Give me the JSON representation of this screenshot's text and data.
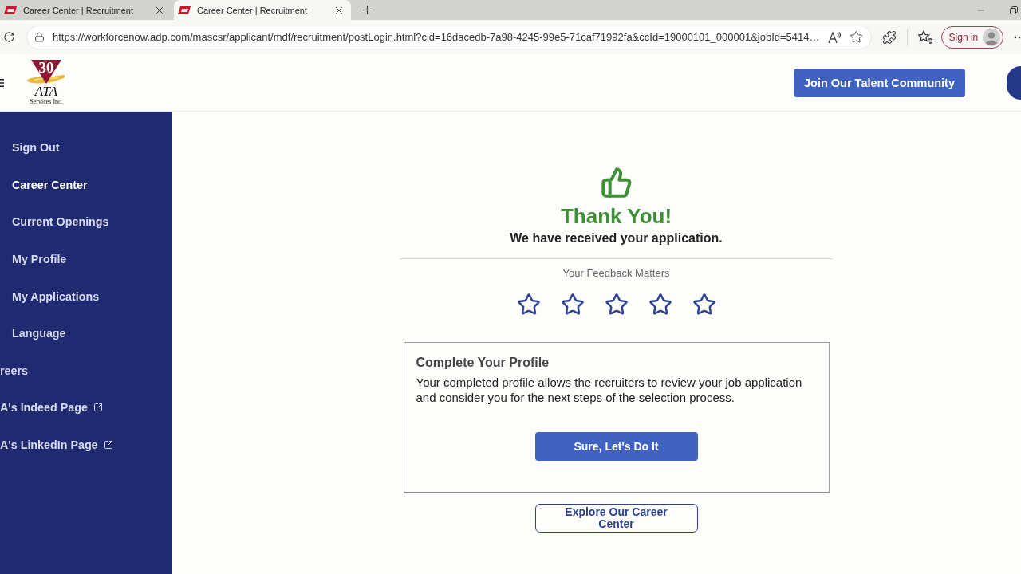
{
  "browser": {
    "tabs": [
      {
        "title": "Career Center | Recruitment",
        "selected": false
      },
      {
        "title": "Career Center | Recruitment",
        "selected": true
      }
    ],
    "address_bar": {
      "url": "https://workforcenow.adp.com/mascsr/applicant/mdf/recruitment/postLogin.html?cid=16dacedb-7a98-4245-99e5-71caf71992fa&ccId=19000101_000001&jobId=5414…"
    },
    "sign_in": "Sign in"
  },
  "header": {
    "logo": {
      "badge": "30",
      "name": "ATA",
      "tagline": "Services Inc."
    },
    "cta_button": "Join Our Talent Community"
  },
  "sidebar": {
    "items": [
      {
        "label": "Sign Out",
        "kind": "nested",
        "selected": false,
        "external": false
      },
      {
        "label": "Career Center",
        "kind": "nested",
        "selected": true,
        "external": false
      },
      {
        "label": "Current Openings",
        "kind": "nested",
        "selected": false,
        "external": false
      },
      {
        "label": "My Profile",
        "kind": "nested",
        "selected": false,
        "external": false
      },
      {
        "label": "My Applications",
        "kind": "nested",
        "selected": false,
        "external": false
      },
      {
        "label": "Language",
        "kind": "nested",
        "selected": false,
        "external": false
      },
      {
        "label": "reers",
        "kind": "top",
        "selected": false,
        "external": false
      },
      {
        "label": "A's Indeed Page",
        "kind": "top",
        "selected": false,
        "external": true
      },
      {
        "label": "A's LinkedIn Page",
        "kind": "top",
        "selected": false,
        "external": true
      }
    ]
  },
  "confirmation": {
    "title": "Thank You!",
    "message": "We have received your application."
  },
  "feedback": {
    "label": "Your Feedback Matters",
    "stars": 0
  },
  "profile_card": {
    "title": "Complete Your Profile",
    "text": "Your completed profile allows the recruiters to review your job application and consider you for the next steps of the selection process.",
    "button": "Sure, Let's Do It"
  },
  "secondary_button": "Explore Our Career Center"
}
